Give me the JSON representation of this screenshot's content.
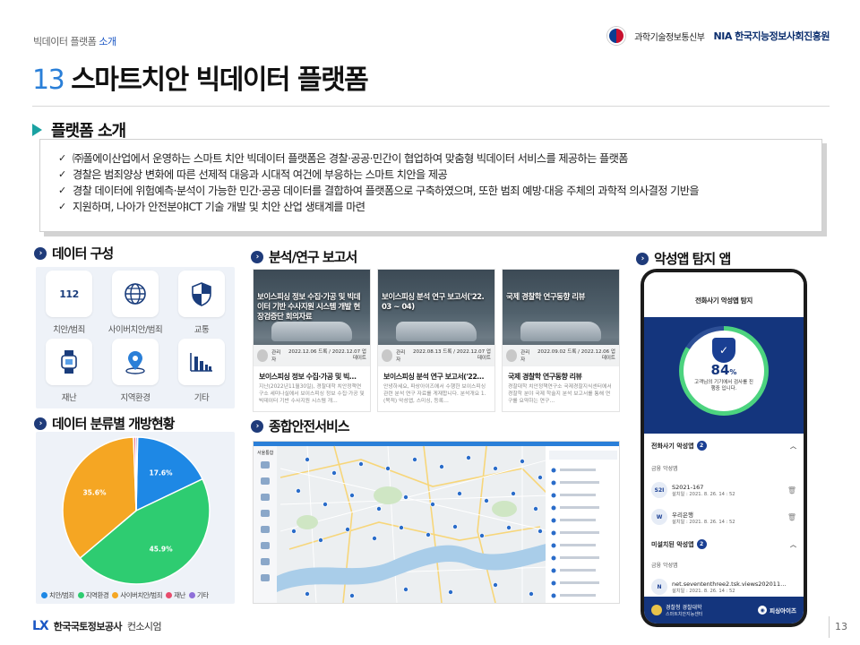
{
  "header": {
    "category": "빅데이터 플랫폼",
    "category_highlight": "소개",
    "ministry": "과학기술정보통신부",
    "nia_abbr": "NIA",
    "nia_name": "한국지능정보사회진흥원"
  },
  "title": {
    "number": "13",
    "text": "스마트치안 빅데이터 플랫폼"
  },
  "intro": {
    "heading": "플랫폼 소개",
    "bullets": [
      "㈜폴에이산업에서 운영하는 스마트 치안 빅데이터 플랫폼은 경찰·공공·민간이 협업하여 맞춤형 빅데이터 서비스를 제공하는 플랫폼",
      "경찰은 범죄양상 변화에 따른 선제적 대응과 시대적 여건에 부응하는 스마트 치안을 제공",
      "경찰 데이터에 위험예측·분석이 가능한 민간·공공 데이터를 결합하여 플랫폼으로 구축하였으며, 또한 범죄 예방·대응 주체의 과학적 의사결정 기반을",
      "지원하며, 나아가 안전분야ICT 기술 개발 및 치안 산업 생태계를 마련"
    ]
  },
  "data_composition": {
    "heading": "데이터 구성",
    "items": [
      {
        "label": "치안/범죄",
        "icon": "112-call-icon",
        "glyph": "112"
      },
      {
        "label": "사이버치안/범죄",
        "icon": "globe-icon",
        "glyph": "🌐"
      },
      {
        "label": "교통",
        "icon": "shield-icon",
        "glyph": "◈"
      },
      {
        "label": "재난",
        "icon": "watch-icon",
        "glyph": "⌚"
      },
      {
        "label": "지역환경",
        "icon": "location-pin-icon",
        "glyph": "⌖"
      },
      {
        "label": "기타",
        "icon": "bar-chart-icon",
        "glyph": "▥"
      }
    ]
  },
  "open_status": {
    "heading": "데이터 분류별 개방현황"
  },
  "chart_data": {
    "type": "pie",
    "title": "",
    "slices": [
      {
        "label": "치안/범죄",
        "value": 17.6,
        "display": "17.6%",
        "color": "#1e88e5"
      },
      {
        "label": "지역환경",
        "value": 45.9,
        "display": "45.9%",
        "color": "#2ecc71"
      },
      {
        "label": "사이버치안/범죄",
        "value": 35.6,
        "display": "35.6%",
        "color": "#f5a623"
      },
      {
        "label": "재난",
        "value": 0.5,
        "display": "",
        "color": "#e74c6c"
      },
      {
        "label": "기타",
        "value": 0.4,
        "display": "",
        "color": "#8e6fd8"
      }
    ],
    "legend": [
      "치안/범죄",
      "지역환경",
      "사이버치안/범죄",
      "재난",
      "기타"
    ],
    "legend_position": "bottom"
  },
  "reports": {
    "heading": "분석/연구 보고서",
    "items": [
      {
        "thumb_title": "보이스피싱 정보 수집·가공 및 빅데이터 기반 수사지원 시스템 개발 현장검증단 회의자료",
        "thumb_sub": "보이스피싱 현장 검증",
        "author": "관리자",
        "dates": "2022.12.06 드록 / 2022.12.07 업데이트",
        "title": "보이스피싱 정보 수집·가공 및 빅…",
        "desc": "지난(2022년11월30일), 경찰대학 치안정책연구소 세미나실에서 보이스피싱 정보 수집·가공 및 빅데이터 기반 수사지원 시스템 개…"
      },
      {
        "thumb_title": "보이스피싱 분석 연구 보고서('22. 03 ~ 04)",
        "thumb_sub": "보이스피싱 분석 연구 보고서('22. 03 ~ 04)",
        "author": "관리자",
        "dates": "2022.08.13 드록 / 2022.12.07 업데이트",
        "title": "보이스피싱 분석 연구 보고서('22…",
        "desc": "안녕하세요, 파상아이즈에서 수행한 보이스피싱 관련 분석 연구 자료를 게재합니다. 분석개요 1. (목적) 악성앱, 스미싱, 등록…"
      },
      {
        "thumb_title": "국제 경찰학 연구동향 리뷰",
        "thumb_sub": "소개 및 연구동향 리뷰",
        "author": "관리자",
        "dates": "2022.09.02 드록 / 2022.12.06 업데이트",
        "title": "국제 경찰학 연구동향 리뷰",
        "desc": "경찰대학 치안정책연구소 국제경찰지식센터에서 경찰학 분야 국제 학술지 분석 보고서를 통해 연구를 요약하는 연구…"
      }
    ]
  },
  "safety_service": {
    "heading": "종합안전서비스",
    "sidebar_title": "서울통합"
  },
  "app": {
    "heading": "악성앱 탐지 앱",
    "screen_title": "전화사기 악성앱 탐지",
    "percent": "84",
    "percent_unit": "%",
    "progress": 0.84,
    "message": "고객님의 기기에서 검사를 진행중 입니다.",
    "section1": {
      "label": "전화사기 악성앱",
      "count": "2"
    },
    "section1_sub": "금융 악성앱",
    "apps1": [
      {
        "name": "S2021-167",
        "meta": "설치일 : 2021. 8. 26. 14 : 52",
        "logo": "S2I"
      },
      {
        "name": "우리은행",
        "meta": "설치일 : 2021. 8. 26. 14 : 52",
        "logo": "W"
      }
    ],
    "section2": {
      "label": "미설치된 악성앱",
      "count": "2"
    },
    "section2_sub": "금융 악성앱",
    "apps2": [
      {
        "name": "net.sevententhree2.tsk.views20201124_t…",
        "meta": "설치일 : 2021. 8. 26. 14 : 52",
        "logo": "N"
      }
    ],
    "footer_org": "경찰청 경찰대학",
    "footer_org_sub": "스마트치안지능센터",
    "footer_brand": "피싱아이즈"
  },
  "footer": {
    "lx": "LX",
    "org": "한국국토정보공사",
    "consortium": "컨소시엄",
    "page": "13"
  }
}
